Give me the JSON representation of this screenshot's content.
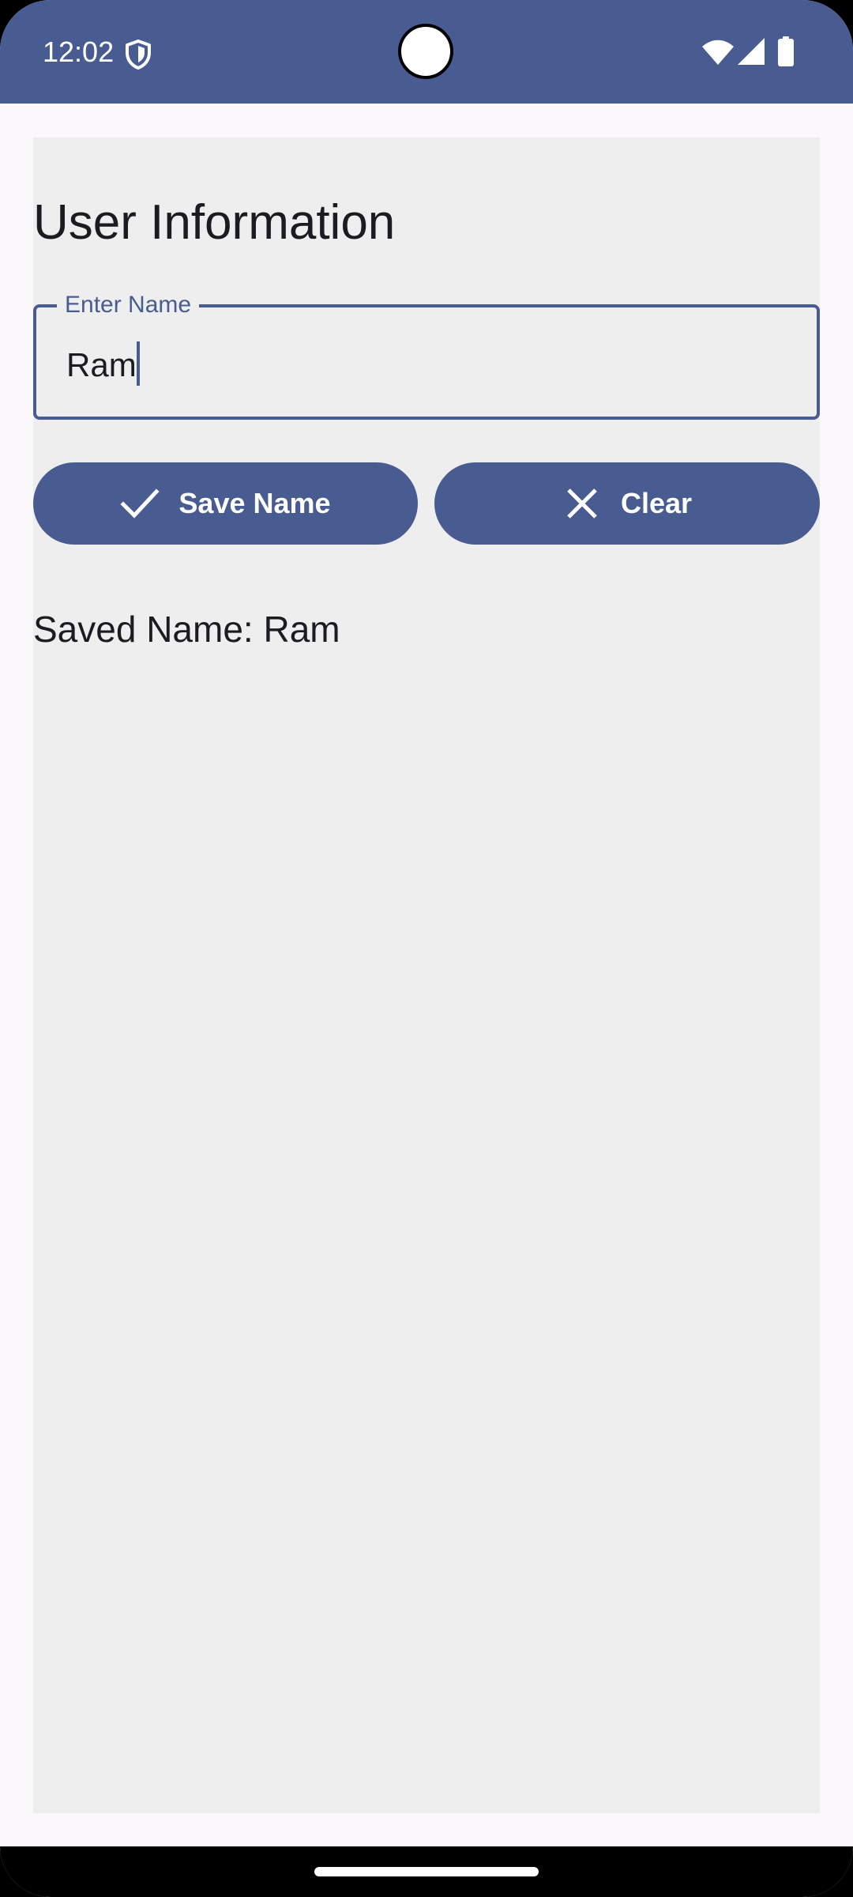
{
  "status_bar": {
    "time": "12:02",
    "icons": [
      "shield-icon",
      "wifi-icon",
      "signal-icon",
      "battery-icon"
    ],
    "background_color": "#485c91"
  },
  "screen": {
    "title": "User Information",
    "name_field": {
      "label": "Enter Name",
      "value": "Ram"
    },
    "save_button": {
      "label": "Save Name",
      "icon": "check-icon"
    },
    "clear_button": {
      "label": "Clear",
      "icon": "close-icon"
    },
    "saved_name_text": "Saved Name: Ram"
  },
  "colors": {
    "accent": "#485c91",
    "content_background": "#eeeeee",
    "page_background": "#fbf8fc",
    "text": "#1b1b21"
  }
}
